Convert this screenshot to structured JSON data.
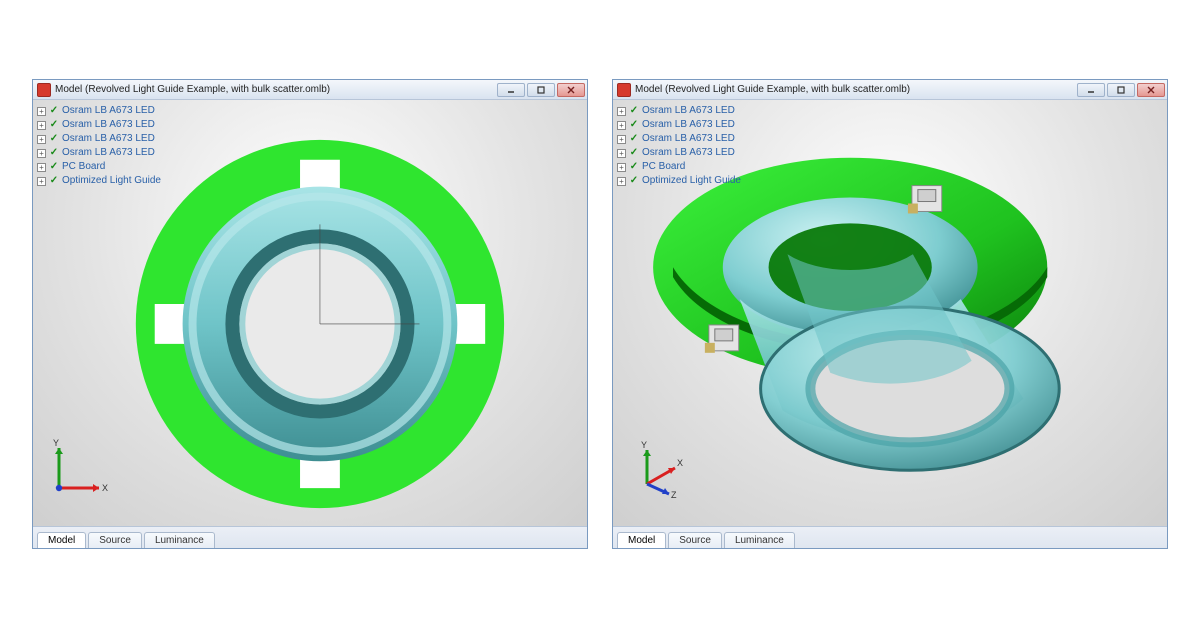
{
  "windows": [
    {
      "title": "Model (Revolved Light Guide Example, with bulk scatter.omlb)",
      "tree": [
        "Osram LB A673 LED",
        "Osram LB A673 LED",
        "Osram LB A673 LED",
        "Osram LB A673 LED",
        "PC Board",
        "Optimized Light Guide"
      ],
      "axes": {
        "y": "Y",
        "x": "X"
      },
      "tabs": [
        "Model",
        "Source",
        "Luminance"
      ],
      "active_tab": 0
    },
    {
      "title": "Model (Revolved Light Guide Example, with bulk scatter.omlb)",
      "tree": [
        "Osram LB A673 LED",
        "Osram LB A673 LED",
        "Osram LB A673 LED",
        "Osram LB A673 LED",
        "PC Board",
        "Optimized Light Guide"
      ],
      "axes": {
        "y": "Y",
        "x": "X",
        "z": "Z"
      },
      "tabs": [
        "Model",
        "Source",
        "Luminance"
      ],
      "active_tab": 0
    }
  ],
  "colors": {
    "board": "#2fe52f",
    "board_shade": "#0a8f0a",
    "guide": "#7ecdd0",
    "guide_dark": "#4aa3a7",
    "cutout": "#ffffff",
    "axis_x": "#d92020",
    "axis_y": "#1a9a1a",
    "axis_z": "#2040c8"
  }
}
